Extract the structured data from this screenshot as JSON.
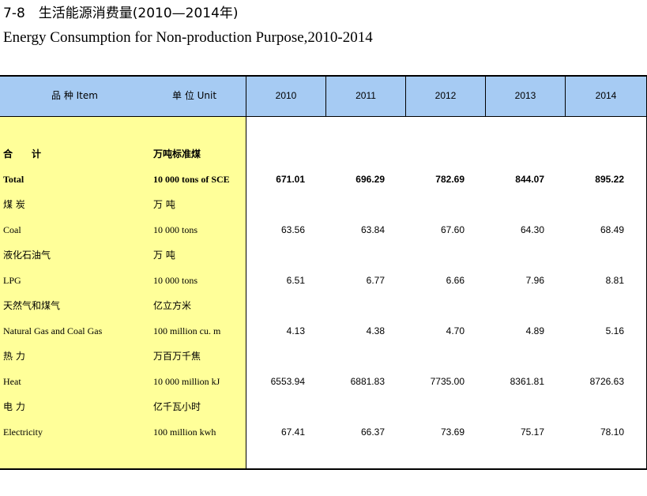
{
  "title": {
    "cn": "7-8　生活能源消费量(2010—2014年)",
    "en": "Energy Consumption for Non-production Purpose,2010-2014"
  },
  "header": {
    "item": "品 种 Item",
    "unit": "单 位  Unit",
    "years": [
      "2010",
      "2011",
      "2012",
      "2013",
      "2014"
    ]
  },
  "rows": [
    {
      "name_cn": "合　　计",
      "unit_cn": "万吨标准煤",
      "name_en": "Total",
      "unit_en": "10 000 tons of SCE",
      "values": [
        "671.01",
        "696.29",
        "782.69",
        "844.07",
        "895.22"
      ],
      "bold": true
    },
    {
      "name_cn": "煤 炭",
      "unit_cn": "万 吨",
      "name_en": "Coal",
      "unit_en": "10 000 tons",
      "values": [
        "63.56",
        "63.84",
        "67.60",
        "64.30",
        "68.49"
      ],
      "bold": false
    },
    {
      "name_cn": "液化石油气",
      "unit_cn": "万 吨",
      "name_en": "LPG",
      "unit_en": "10 000 tons",
      "values": [
        "6.51",
        "6.77",
        "6.66",
        "7.96",
        "8.81"
      ],
      "bold": false
    },
    {
      "name_cn": "天然气和煤气",
      "unit_cn": "亿立方米",
      "name_en": "Natural Gas and Coal Gas",
      "unit_en": "100 million cu. m",
      "values": [
        "4.13",
        "4.38",
        "4.70",
        "4.89",
        "5.16"
      ],
      "bold": false
    },
    {
      "name_cn": "热 力",
      "unit_cn": "万百万千焦",
      "name_en": "Heat",
      "unit_en": "10 000 million kJ",
      "values": [
        "6553.94",
        "6881.83",
        "7735.00",
        "8361.81",
        "8726.63"
      ],
      "bold": false
    },
    {
      "name_cn": "电 力",
      "unit_cn": "亿千瓦小时",
      "name_en": "Electricity",
      "unit_en": "100 million kwh",
      "values": [
        "67.41",
        "66.37",
        "73.69",
        "75.17",
        "78.10"
      ],
      "bold": false
    }
  ]
}
